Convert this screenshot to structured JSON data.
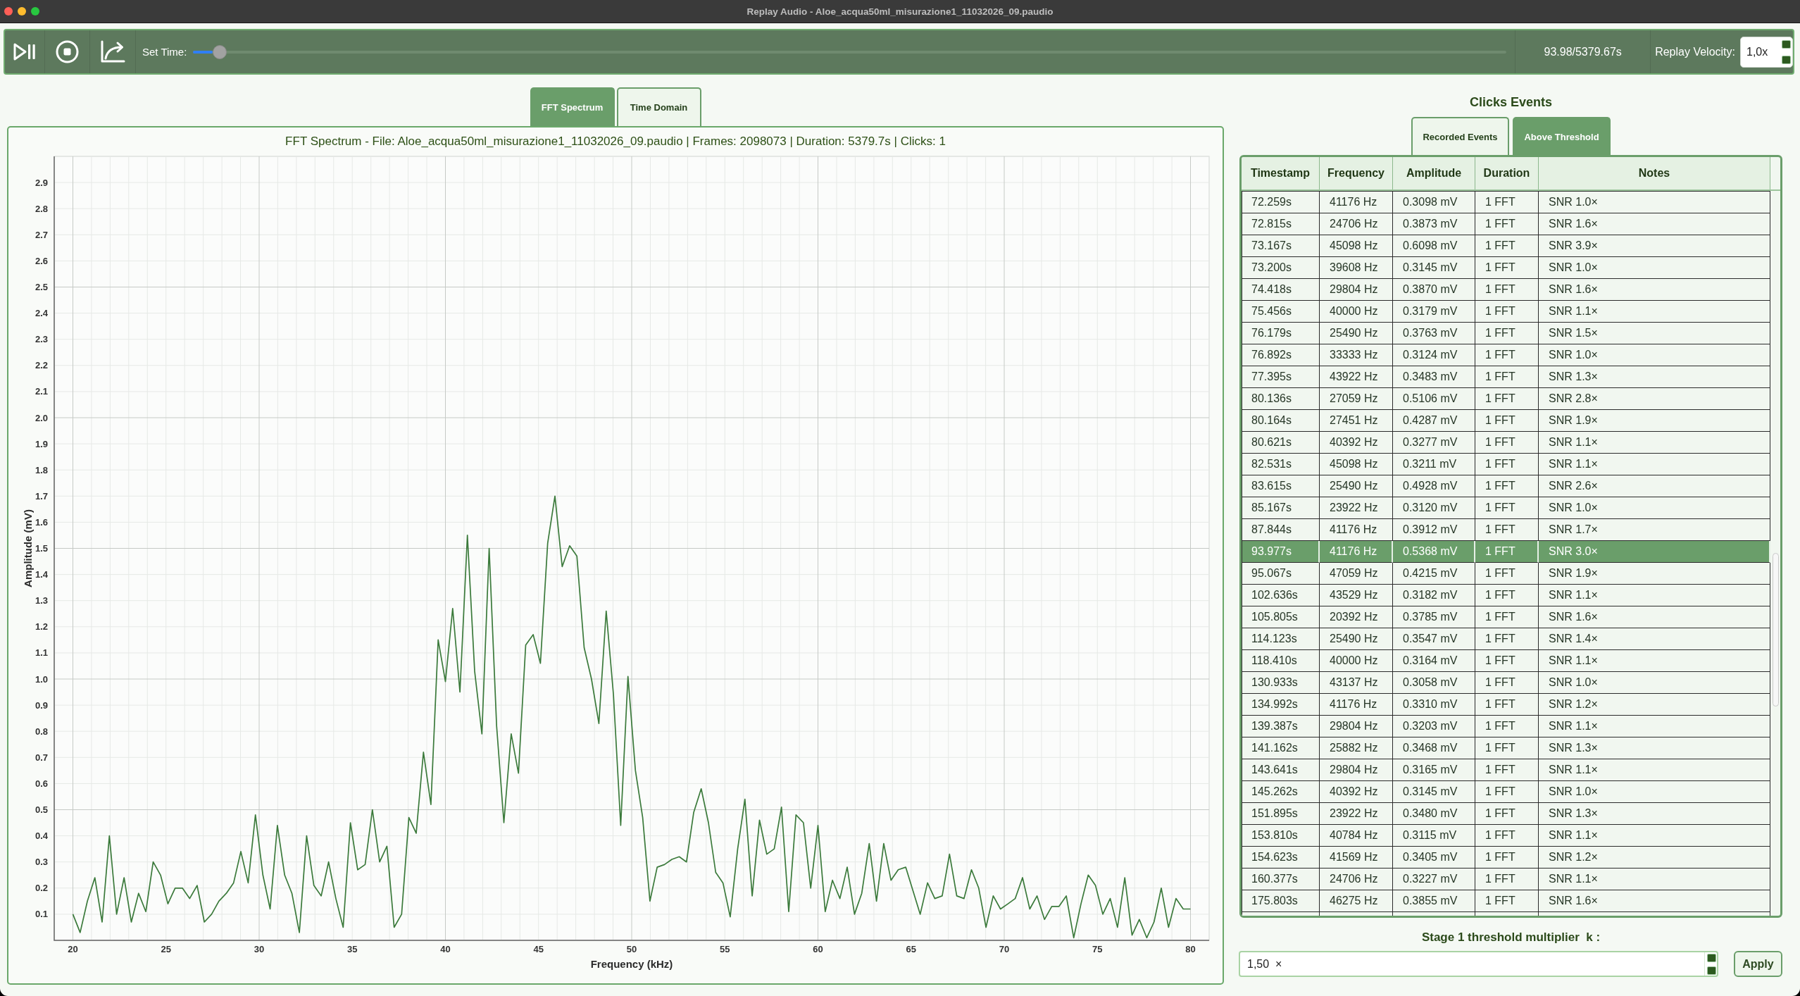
{
  "window": {
    "title": "Replay Audio - Aloe_acqua50ml_misurazione1_11032026_09.paudio"
  },
  "toolbar": {
    "set_time_label": "Set Time:",
    "time_slider": {
      "level": 0.02
    },
    "time_readout": "93.98/5379.67s",
    "velocity_label": "Replay Velocity:",
    "velocity_value": "1,0x"
  },
  "view_tabs": [
    {
      "label": "FFT Spectrum",
      "selected": true
    },
    {
      "label": "Time Domain",
      "selected": false
    }
  ],
  "spectrum_panel": {
    "chart_data": {
      "type": "line",
      "title": "FFT Spectrum - File: Aloe_acqua50ml_misurazione1_11032026_09.paudio | Frames: 2098073 | Duration: 5379.7s | Clicks: 1",
      "xlabel": "Frequency (kHz)",
      "ylabel": "Amplitude (mV)",
      "grid": true,
      "x": [
        20.0,
        20.39,
        20.78,
        21.18,
        21.57,
        21.96,
        22.35,
        22.75,
        23.14,
        23.53,
        23.92,
        24.31,
        24.71,
        25.1,
        25.49,
        25.88,
        26.27,
        26.67,
        27.06,
        27.45,
        27.84,
        28.24,
        28.63,
        29.02,
        29.41,
        29.8,
        30.2,
        30.59,
        30.98,
        31.37,
        31.76,
        32.16,
        32.55,
        32.94,
        33.33,
        33.73,
        34.12,
        34.51,
        34.9,
        35.29,
        35.69,
        36.08,
        36.47,
        36.86,
        37.25,
        37.65,
        38.04,
        38.43,
        38.82,
        39.22,
        39.61,
        40.0,
        40.39,
        40.78,
        41.18,
        41.57,
        41.96,
        42.35,
        42.75,
        43.14,
        43.53,
        43.92,
        44.31,
        44.71,
        45.1,
        45.49,
        45.88,
        46.27,
        46.67,
        47.06,
        47.45,
        47.84,
        48.24,
        48.63,
        49.02,
        49.41,
        49.8,
        50.2,
        50.59,
        50.98,
        51.37,
        51.76,
        52.16,
        52.55,
        52.94,
        53.33,
        53.73,
        54.12,
        54.51,
        54.9,
        55.29,
        55.69,
        56.08,
        56.47,
        56.86,
        57.25,
        57.65,
        58.04,
        58.43,
        58.82,
        59.22,
        59.61,
        60.0,
        60.39,
        60.78,
        61.18,
        61.57,
        61.96,
        62.35,
        62.75,
        63.14,
        63.53,
        63.92,
        64.31,
        64.71,
        65.1,
        65.49,
        65.88,
        66.27,
        66.67,
        67.06,
        67.45,
        67.84,
        68.24,
        68.63,
        69.02,
        69.41,
        69.8,
        70.2,
        70.59,
        70.98,
        71.37,
        71.76,
        72.16,
        72.55,
        72.94,
        73.33,
        73.73,
        74.12,
        74.51,
        74.9,
        75.29,
        75.69,
        76.08,
        76.47,
        76.86,
        77.25,
        77.65,
        78.04,
        78.43,
        78.82,
        79.22,
        79.61,
        80.0
      ],
      "series": [
        {
          "color": "#3b7a3b",
          "values": [
            0.1,
            0.03,
            0.15,
            0.24,
            0.07,
            0.4,
            0.1,
            0.24,
            0.07,
            0.18,
            0.11,
            0.3,
            0.25,
            0.14,
            0.2,
            0.2,
            0.16,
            0.21,
            0.07,
            0.1,
            0.15,
            0.18,
            0.22,
            0.34,
            0.22,
            0.48,
            0.25,
            0.12,
            0.44,
            0.25,
            0.18,
            0.03,
            0.4,
            0.21,
            0.17,
            0.3,
            0.16,
            0.05,
            0.45,
            0.27,
            0.29,
            0.5,
            0.3,
            0.36,
            0.05,
            0.1,
            0.47,
            0.41,
            0.72,
            0.52,
            1.15,
            0.99,
            1.27,
            0.95,
            1.55,
            1.03,
            0.79,
            1.5,
            0.82,
            0.45,
            0.79,
            0.64,
            1.13,
            1.17,
            1.06,
            1.52,
            1.7,
            1.43,
            1.51,
            1.47,
            1.12,
            1.0,
            0.83,
            1.26,
            0.94,
            0.44,
            1.01,
            0.65,
            0.47,
            0.15,
            0.28,
            0.29,
            0.31,
            0.32,
            0.3,
            0.49,
            0.58,
            0.45,
            0.26,
            0.22,
            0.09,
            0.35,
            0.54,
            0.17,
            0.46,
            0.33,
            0.35,
            0.51,
            0.11,
            0.48,
            0.45,
            0.2,
            0.44,
            0.11,
            0.23,
            0.16,
            0.28,
            0.1,
            0.18,
            0.37,
            0.15,
            0.37,
            0.23,
            0.27,
            0.28,
            0.19,
            0.1,
            0.22,
            0.16,
            0.17,
            0.33,
            0.17,
            0.16,
            0.27,
            0.2,
            0.05,
            0.17,
            0.12,
            0.14,
            0.16,
            0.24,
            0.12,
            0.17,
            0.08,
            0.13,
            0.13,
            0.17,
            0.01,
            0.14,
            0.25,
            0.21,
            0.1,
            0.16,
            0.05,
            0.24,
            0.02,
            0.08,
            0.01,
            0.07,
            0.2,
            0.05,
            0.16,
            0.12,
            0.12
          ]
        }
      ],
      "xlim": [
        19,
        81
      ],
      "ylim": [
        0,
        3
      ],
      "xticks": [
        20,
        25,
        30,
        35,
        40,
        45,
        50,
        55,
        60,
        65,
        70,
        75,
        80
      ],
      "yticks": [
        0.1,
        0.2,
        0.3,
        0.4,
        0.5,
        0.6,
        0.7,
        0.8,
        0.9,
        {
          "value": 1,
          "label": "1.0"
        },
        1.1,
        1.2,
        1.3,
        1.4,
        1.5,
        1.6,
        1.7,
        1.8,
        1.9,
        {
          "value": 2,
          "label": "2.0"
        },
        2.1,
        2.2,
        2.3,
        2.4,
        2.5,
        2.6,
        2.7,
        2.8,
        2.9
      ]
    }
  },
  "events_panel": {
    "title": "Clicks Events",
    "tabs": [
      {
        "label": "Recorded Events",
        "selected": false
      },
      {
        "label": "Above Threshold",
        "selected": true
      }
    ],
    "table": {
      "columns": [
        "Timestamp",
        "Frequency",
        "Amplitude",
        "Duration",
        "Notes"
      ],
      "rows": [
        {
          "cells": [
            "72.259s",
            "41176 Hz",
            "0.3098 mV",
            "1 FFT",
            "SNR 1.0×"
          ],
          "selected": false
        },
        {
          "cells": [
            "72.815s",
            "24706 Hz",
            "0.3873 mV",
            "1 FFT",
            "SNR 1.6×"
          ],
          "selected": false
        },
        {
          "cells": [
            "73.167s",
            "45098 Hz",
            "0.6098 mV",
            "1 FFT",
            "SNR 3.9×"
          ],
          "selected": false
        },
        {
          "cells": [
            "73.200s",
            "39608 Hz",
            "0.3145 mV",
            "1 FFT",
            "SNR 1.0×"
          ],
          "selected": false
        },
        {
          "cells": [
            "74.418s",
            "29804 Hz",
            "0.3870 mV",
            "1 FFT",
            "SNR 1.6×"
          ],
          "selected": false
        },
        {
          "cells": [
            "75.456s",
            "40000 Hz",
            "0.3179 mV",
            "1 FFT",
            "SNR 1.1×"
          ],
          "selected": false
        },
        {
          "cells": [
            "76.179s",
            "25490 Hz",
            "0.3763 mV",
            "1 FFT",
            "SNR 1.5×"
          ],
          "selected": false
        },
        {
          "cells": [
            "76.892s",
            "33333 Hz",
            "0.3124 mV",
            "1 FFT",
            "SNR 1.0×"
          ],
          "selected": false
        },
        {
          "cells": [
            "77.395s",
            "43922 Hz",
            "0.3483 mV",
            "1 FFT",
            "SNR 1.3×"
          ],
          "selected": false
        },
        {
          "cells": [
            "80.136s",
            "27059 Hz",
            "0.5106 mV",
            "1 FFT",
            "SNR 2.8×"
          ],
          "selected": false
        },
        {
          "cells": [
            "80.164s",
            "27451 Hz",
            "0.4287 mV",
            "1 FFT",
            "SNR 1.9×"
          ],
          "selected": false
        },
        {
          "cells": [
            "80.621s",
            "40392 Hz",
            "0.3277 mV",
            "1 FFT",
            "SNR 1.1×"
          ],
          "selected": false
        },
        {
          "cells": [
            "82.531s",
            "45098 Hz",
            "0.3211 mV",
            "1 FFT",
            "SNR 1.1×"
          ],
          "selected": false
        },
        {
          "cells": [
            "83.615s",
            "25490 Hz",
            "0.4928 mV",
            "1 FFT",
            "SNR 2.6×"
          ],
          "selected": false
        },
        {
          "cells": [
            "85.167s",
            "23922 Hz",
            "0.3120 mV",
            "1 FFT",
            "SNR 1.0×"
          ],
          "selected": false
        },
        {
          "cells": [
            "87.844s",
            "41176 Hz",
            "0.3912 mV",
            "1 FFT",
            "SNR 1.7×"
          ],
          "selected": false
        },
        {
          "cells": [
            "93.977s",
            "41176 Hz",
            "0.5368 mV",
            "1 FFT",
            "SNR 3.0×"
          ],
          "selected": true
        },
        {
          "cells": [
            "95.067s",
            "47059 Hz",
            "0.4215 mV",
            "1 FFT",
            "SNR 1.9×"
          ],
          "selected": false
        },
        {
          "cells": [
            "102.636s",
            "43529 Hz",
            "0.3182 mV",
            "1 FFT",
            "SNR 1.1×"
          ],
          "selected": false
        },
        {
          "cells": [
            "105.805s",
            "20392 Hz",
            "0.3785 mV",
            "1 FFT",
            "SNR 1.6×"
          ],
          "selected": false
        },
        {
          "cells": [
            "114.123s",
            "25490 Hz",
            "0.3547 mV",
            "1 FFT",
            "SNR 1.4×"
          ],
          "selected": false
        },
        {
          "cells": [
            "118.410s",
            "40000 Hz",
            "0.3164 mV",
            "1 FFT",
            "SNR 1.1×"
          ],
          "selected": false
        },
        {
          "cells": [
            "130.933s",
            "43137 Hz",
            "0.3058 mV",
            "1 FFT",
            "SNR 1.0×"
          ],
          "selected": false
        },
        {
          "cells": [
            "134.992s",
            "41176 Hz",
            "0.3310 mV",
            "1 FFT",
            "SNR 1.2×"
          ],
          "selected": false
        },
        {
          "cells": [
            "139.387s",
            "29804 Hz",
            "0.3203 mV",
            "1 FFT",
            "SNR 1.1×"
          ],
          "selected": false
        },
        {
          "cells": [
            "141.162s",
            "25882 Hz",
            "0.3468 mV",
            "1 FFT",
            "SNR 1.3×"
          ],
          "selected": false
        },
        {
          "cells": [
            "143.641s",
            "29804 Hz",
            "0.3165 mV",
            "1 FFT",
            "SNR 1.1×"
          ],
          "selected": false
        },
        {
          "cells": [
            "145.262s",
            "40392 Hz",
            "0.3145 mV",
            "1 FFT",
            "SNR 1.0×"
          ],
          "selected": false
        },
        {
          "cells": [
            "151.895s",
            "23922 Hz",
            "0.3480 mV",
            "1 FFT",
            "SNR 1.3×"
          ],
          "selected": false
        },
        {
          "cells": [
            "153.810s",
            "40784 Hz",
            "0.3115 mV",
            "1 FFT",
            "SNR 1.1×"
          ],
          "selected": false
        },
        {
          "cells": [
            "154.623s",
            "41569 Hz",
            "0.3405 mV",
            "1 FFT",
            "SNR 1.2×"
          ],
          "selected": false
        },
        {
          "cells": [
            "160.377s",
            "24706 Hz",
            "0.3227 mV",
            "1 FFT",
            "SNR 1.1×"
          ],
          "selected": false
        },
        {
          "cells": [
            "175.803s",
            "46275 Hz",
            "0.3855 mV",
            "1 FFT",
            "SNR 1.6×"
          ],
          "selected": false
        }
      ]
    }
  },
  "threshold": {
    "label": "Stage 1 threshold multiplier  k :",
    "value": "1,50  ×",
    "apply_button": "Apply"
  }
}
